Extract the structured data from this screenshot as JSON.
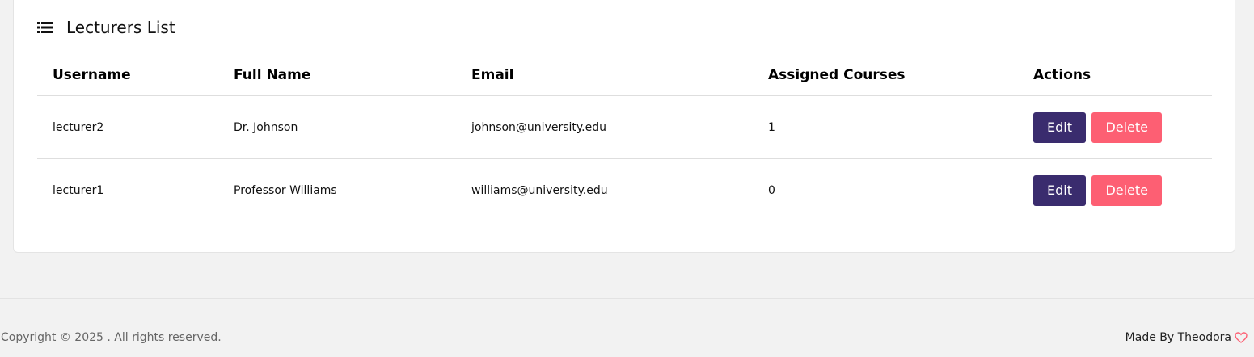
{
  "card": {
    "title": "Lecturers List",
    "icon": "list-icon"
  },
  "table": {
    "headers": [
      "Username",
      "Full Name",
      "Email",
      "Assigned Courses",
      "Actions"
    ],
    "rows": [
      {
        "username": "lecturer2",
        "full_name": "Dr. Johnson",
        "email": "johnson@university.edu",
        "assigned_courses": "1",
        "edit_label": "Edit",
        "delete_label": "Delete"
      },
      {
        "username": "lecturer1",
        "full_name": "Professor Williams",
        "email": "williams@university.edu",
        "assigned_courses": "0",
        "edit_label": "Edit",
        "delete_label": "Delete"
      }
    ]
  },
  "footer": {
    "copyright": "Copyright © 2025 . All rights reserved.",
    "made_by": "Made By Theodora",
    "heart_icon": "heart-icon"
  },
  "colors": {
    "edit_button": "#3a2c6e",
    "delete_button": "#fd5f73",
    "heart": "#fd5f73"
  }
}
